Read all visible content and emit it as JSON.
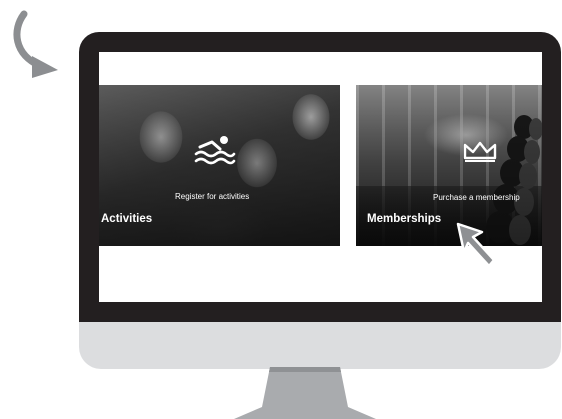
{
  "tiles": {
    "activities": {
      "title": "Activities",
      "description": "Register for activities",
      "icon": "swimmer-icon"
    },
    "memberships": {
      "title": "Memberships",
      "description": "Purchase a membership",
      "icon": "crown-icon"
    }
  },
  "colors": {
    "monitor_bezel": "#231f20",
    "monitor_chin": "#dcdddf",
    "stand": "#a9abae",
    "arrow": "#8c8e91",
    "cursor": "#8e9093"
  }
}
